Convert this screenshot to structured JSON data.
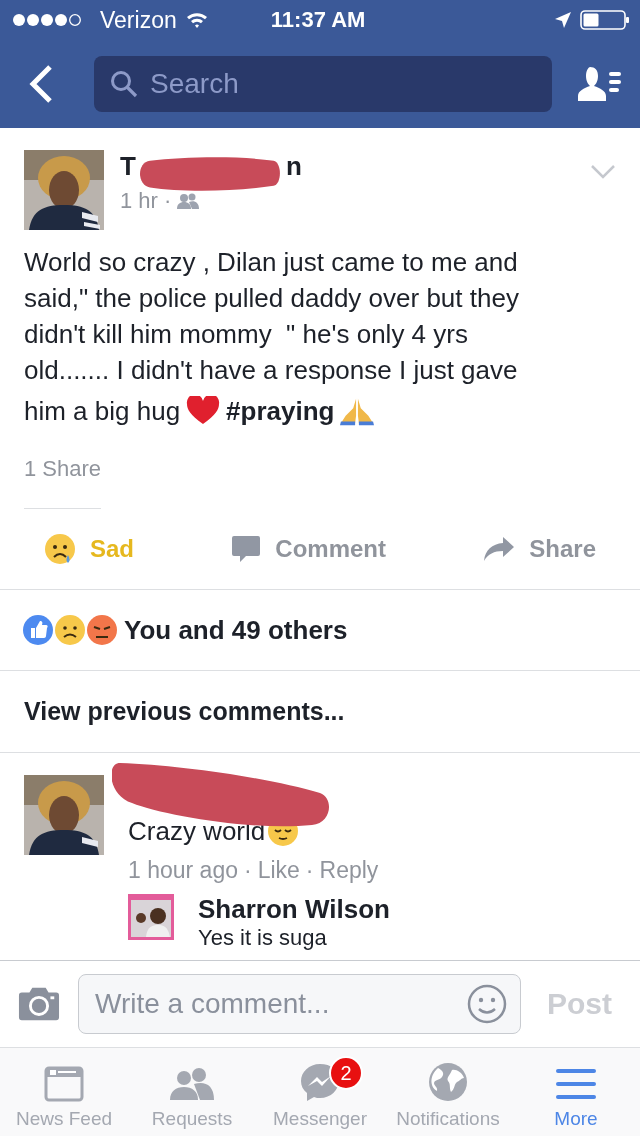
{
  "status_bar": {
    "carrier": "Verizon",
    "time": "11:37 AM"
  },
  "nav": {
    "search_placeholder": "Search"
  },
  "post": {
    "author_first": "T",
    "author_last": "n",
    "time": "1 hr",
    "separator": "·",
    "lines": [
      "World so crazy , Dilan just came to me and",
      "said,\" the police pulled daddy over but they",
      "didn't kill him mommy  \" he's only 4 yrs",
      "old....... I didn't have a response I just gave"
    ],
    "last_line": "him a big hug",
    "hashtag": "#praying",
    "shares": "1 Share"
  },
  "actions": [
    {
      "kind": "sad",
      "label": "Sad",
      "selected": true
    },
    {
      "kind": "comment",
      "label": "Comment",
      "selected": false
    },
    {
      "kind": "share",
      "label": "Share",
      "selected": false
    }
  ],
  "reactions": {
    "summary": "You and 49 others"
  },
  "view_previous": "View previous comments...",
  "comments": [
    {
      "text": "Crazy world",
      "meta": [
        "1 hour ago",
        "·",
        "Like",
        "·",
        "Reply"
      ],
      "replies": [
        {
          "author": "Sharron Wilson",
          "text": "Yes it is suga"
        }
      ]
    }
  ],
  "composer": {
    "placeholder": "Write a comment...",
    "post": "Post"
  },
  "tabs": [
    {
      "kind": "feed",
      "label": "News Feed",
      "selected": false
    },
    {
      "kind": "requests",
      "label": "Requests",
      "selected": false
    },
    {
      "kind": "messenger",
      "label": "Messenger",
      "selected": false,
      "badge": "2"
    },
    {
      "kind": "globe",
      "label": "Notifications",
      "selected": false
    },
    {
      "kind": "more",
      "label": "More",
      "selected": true
    }
  ]
}
